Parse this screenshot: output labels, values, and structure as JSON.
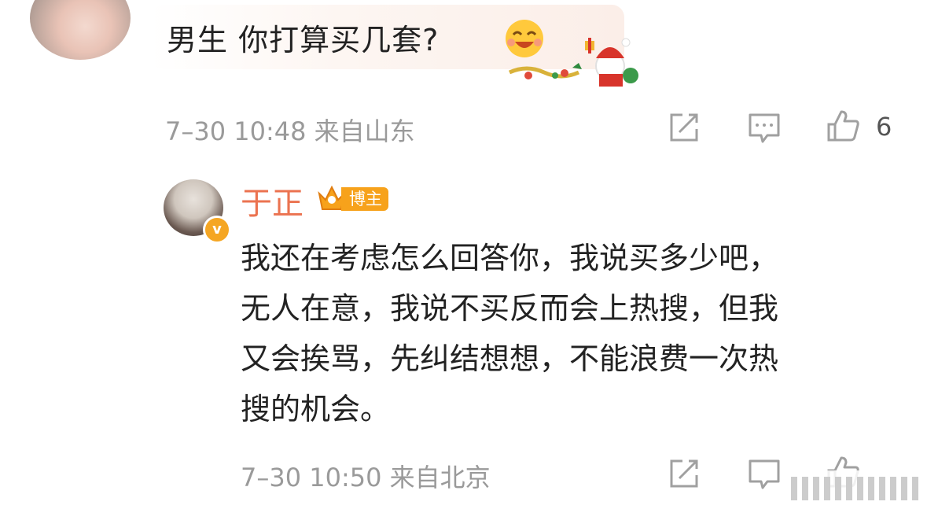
{
  "top_comment": {
    "text": "男生 你打算买几套?",
    "meta": "7–30 10:48 来自山东",
    "like_count": "6"
  },
  "reply": {
    "name": "于正",
    "badge_label": "博主",
    "lines": [
      "我还在考虑怎么回答你，我说买多少吧，",
      "无人在意，我说不买反而会上热搜，但我",
      "又会挨骂，先纠结想想，不能浪费一次热",
      "搜的机会。"
    ],
    "meta": "7–30 10:50 来自北京"
  },
  "icons": {
    "share": "share-icon",
    "comment": "comment-icon",
    "like": "thumbs-up-icon"
  },
  "colors": {
    "accent": "#eb7350",
    "meta": "#9a9a9a",
    "badge": "#f7a21b",
    "icon": "#a0a0a0"
  }
}
